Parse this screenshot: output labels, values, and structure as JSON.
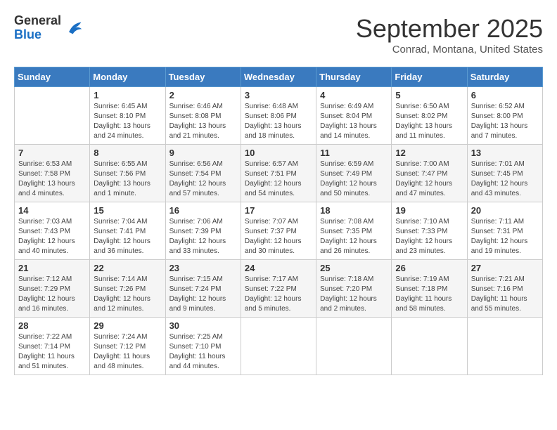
{
  "header": {
    "logo": {
      "general": "General",
      "blue": "Blue"
    },
    "month_title": "September 2025",
    "subtitle": "Conrad, Montana, United States"
  },
  "weekdays": [
    "Sunday",
    "Monday",
    "Tuesday",
    "Wednesday",
    "Thursday",
    "Friday",
    "Saturday"
  ],
  "weeks": [
    [
      {
        "day": "",
        "info": ""
      },
      {
        "day": "1",
        "info": "Sunrise: 6:45 AM\nSunset: 8:10 PM\nDaylight: 13 hours\nand 24 minutes."
      },
      {
        "day": "2",
        "info": "Sunrise: 6:46 AM\nSunset: 8:08 PM\nDaylight: 13 hours\nand 21 minutes."
      },
      {
        "day": "3",
        "info": "Sunrise: 6:48 AM\nSunset: 8:06 PM\nDaylight: 13 hours\nand 18 minutes."
      },
      {
        "day": "4",
        "info": "Sunrise: 6:49 AM\nSunset: 8:04 PM\nDaylight: 13 hours\nand 14 minutes."
      },
      {
        "day": "5",
        "info": "Sunrise: 6:50 AM\nSunset: 8:02 PM\nDaylight: 13 hours\nand 11 minutes."
      },
      {
        "day": "6",
        "info": "Sunrise: 6:52 AM\nSunset: 8:00 PM\nDaylight: 13 hours\nand 7 minutes."
      }
    ],
    [
      {
        "day": "7",
        "info": "Sunrise: 6:53 AM\nSunset: 7:58 PM\nDaylight: 13 hours\nand 4 minutes."
      },
      {
        "day": "8",
        "info": "Sunrise: 6:55 AM\nSunset: 7:56 PM\nDaylight: 13 hours\nand 1 minute."
      },
      {
        "day": "9",
        "info": "Sunrise: 6:56 AM\nSunset: 7:54 PM\nDaylight: 12 hours\nand 57 minutes."
      },
      {
        "day": "10",
        "info": "Sunrise: 6:57 AM\nSunset: 7:51 PM\nDaylight: 12 hours\nand 54 minutes."
      },
      {
        "day": "11",
        "info": "Sunrise: 6:59 AM\nSunset: 7:49 PM\nDaylight: 12 hours\nand 50 minutes."
      },
      {
        "day": "12",
        "info": "Sunrise: 7:00 AM\nSunset: 7:47 PM\nDaylight: 12 hours\nand 47 minutes."
      },
      {
        "day": "13",
        "info": "Sunrise: 7:01 AM\nSunset: 7:45 PM\nDaylight: 12 hours\nand 43 minutes."
      }
    ],
    [
      {
        "day": "14",
        "info": "Sunrise: 7:03 AM\nSunset: 7:43 PM\nDaylight: 12 hours\nand 40 minutes."
      },
      {
        "day": "15",
        "info": "Sunrise: 7:04 AM\nSunset: 7:41 PM\nDaylight: 12 hours\nand 36 minutes."
      },
      {
        "day": "16",
        "info": "Sunrise: 7:06 AM\nSunset: 7:39 PM\nDaylight: 12 hours\nand 33 minutes."
      },
      {
        "day": "17",
        "info": "Sunrise: 7:07 AM\nSunset: 7:37 PM\nDaylight: 12 hours\nand 30 minutes."
      },
      {
        "day": "18",
        "info": "Sunrise: 7:08 AM\nSunset: 7:35 PM\nDaylight: 12 hours\nand 26 minutes."
      },
      {
        "day": "19",
        "info": "Sunrise: 7:10 AM\nSunset: 7:33 PM\nDaylight: 12 hours\nand 23 minutes."
      },
      {
        "day": "20",
        "info": "Sunrise: 7:11 AM\nSunset: 7:31 PM\nDaylight: 12 hours\nand 19 minutes."
      }
    ],
    [
      {
        "day": "21",
        "info": "Sunrise: 7:12 AM\nSunset: 7:29 PM\nDaylight: 12 hours\nand 16 minutes."
      },
      {
        "day": "22",
        "info": "Sunrise: 7:14 AM\nSunset: 7:26 PM\nDaylight: 12 hours\nand 12 minutes."
      },
      {
        "day": "23",
        "info": "Sunrise: 7:15 AM\nSunset: 7:24 PM\nDaylight: 12 hours\nand 9 minutes."
      },
      {
        "day": "24",
        "info": "Sunrise: 7:17 AM\nSunset: 7:22 PM\nDaylight: 12 hours\nand 5 minutes."
      },
      {
        "day": "25",
        "info": "Sunrise: 7:18 AM\nSunset: 7:20 PM\nDaylight: 12 hours\nand 2 minutes."
      },
      {
        "day": "26",
        "info": "Sunrise: 7:19 AM\nSunset: 7:18 PM\nDaylight: 11 hours\nand 58 minutes."
      },
      {
        "day": "27",
        "info": "Sunrise: 7:21 AM\nSunset: 7:16 PM\nDaylight: 11 hours\nand 55 minutes."
      }
    ],
    [
      {
        "day": "28",
        "info": "Sunrise: 7:22 AM\nSunset: 7:14 PM\nDaylight: 11 hours\nand 51 minutes."
      },
      {
        "day": "29",
        "info": "Sunrise: 7:24 AM\nSunset: 7:12 PM\nDaylight: 11 hours\nand 48 minutes."
      },
      {
        "day": "30",
        "info": "Sunrise: 7:25 AM\nSunset: 7:10 PM\nDaylight: 11 hours\nand 44 minutes."
      },
      {
        "day": "",
        "info": ""
      },
      {
        "day": "",
        "info": ""
      },
      {
        "day": "",
        "info": ""
      },
      {
        "day": "",
        "info": ""
      }
    ]
  ]
}
